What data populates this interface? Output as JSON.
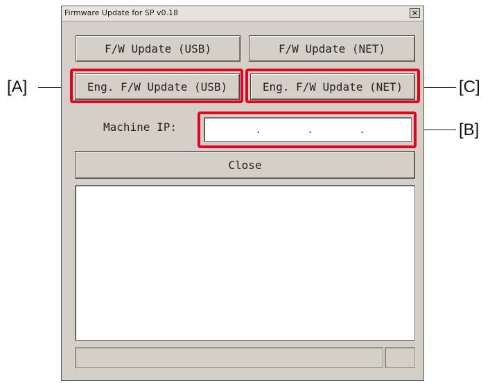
{
  "window": {
    "title": "Firmware Update for SP v0.18",
    "close_glyph": "×"
  },
  "buttons": {
    "fw_usb": "F/W Update (USB)",
    "fw_net": "F/W Update (NET)",
    "eng_usb": "Eng. F/W Update (USB)",
    "eng_net": "Eng. F/W Update (NET)",
    "close": "Close"
  },
  "machine_ip": {
    "label": "Machine IP:",
    "dots": [
      ".",
      ".",
      "."
    ]
  },
  "callouts": {
    "a": "[A]",
    "b": "[B]",
    "c": "[C]"
  },
  "colors": {
    "highlight": "#e8001c",
    "window_bg": "#d4d0c8"
  }
}
